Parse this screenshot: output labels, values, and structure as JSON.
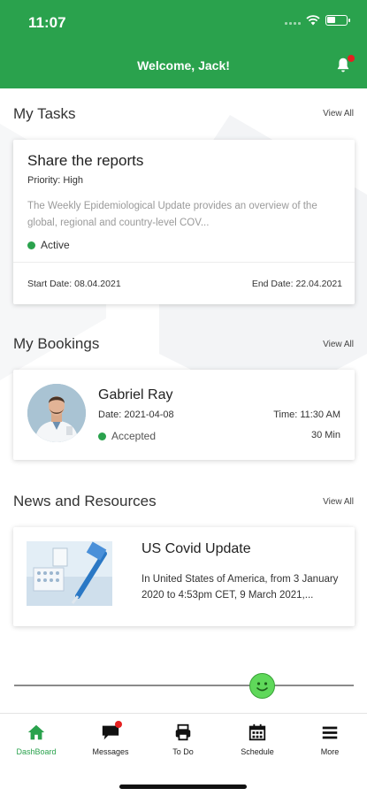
{
  "status_bar": {
    "time": "11:07",
    "battery_level": 0.45
  },
  "header": {
    "welcome": "Welcome, Jack!",
    "notification_icon": "bell-icon",
    "has_notification": true
  },
  "tasks": {
    "section_title": "My Tasks",
    "view_all": "View All",
    "card": {
      "title": "Share the reports",
      "priority": "Priority: High",
      "description": "The Weekly Epidemiological Update provides an overview of the global, regional and country-level COV...",
      "status": "Active",
      "start_date": "Start Date: 08.04.2021",
      "end_date": "End Date: 22.04.2021"
    }
  },
  "bookings": {
    "section_title": "My Bookings",
    "view_all": "View All",
    "card": {
      "name": "Gabriel Ray",
      "date": "Date: 2021-04-08",
      "time": "Time: 11:30 AM",
      "status": "Accepted",
      "duration": "30 Min"
    }
  },
  "news": {
    "section_title": "News and Resources",
    "view_all": "View All",
    "card": {
      "title": "US Covid Update",
      "description": "In United States of America, from 3 January 2020 to 4:53pm CET, 9 March 2021,..."
    }
  },
  "slider": {
    "value": 0.73,
    "knob_icon": "smiley-face-icon"
  },
  "tabbar": {
    "items": [
      {
        "label": "DashBoard",
        "icon": "home-icon",
        "active": true
      },
      {
        "label": "Messages",
        "icon": "chat-bubble-icon",
        "active": false
      },
      {
        "label": "To Do",
        "icon": "printer-icon",
        "active": false
      },
      {
        "label": "Schedule",
        "icon": "calendar-icon",
        "active": false
      },
      {
        "label": "More",
        "icon": "menu-icon",
        "active": false
      }
    ]
  },
  "colors": {
    "brand_green": "#2aa24d",
    "notification_red": "#e52020",
    "status_green": "#2aa24d"
  }
}
